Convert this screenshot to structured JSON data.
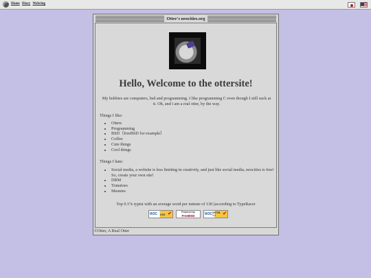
{
  "topbar": {
    "nav": [
      "Home",
      "Diary",
      "Webring"
    ],
    "languages": [
      "jp-flag",
      "us-flag"
    ]
  },
  "window": {
    "title": "Otter's neocities.org"
  },
  "main": {
    "heading": "Hello, Welcome to the ottersite!",
    "intro": "My hobbies are computers, bsd and programming. I like programming C even though I still suck at it. Oh, and i am a real otter, by the way.",
    "likes_label": "Things I like:",
    "likes": [
      "Otters",
      "Programming",
      "BSD（freeBSD for example）",
      "Coffee",
      "Cute things",
      "Cool things"
    ],
    "hates_label": "Things I hate:",
    "hates": [
      "Social media, a website is less limiting in creativity, and just like social media, neocities is free! So, create your own site!",
      "DRM",
      "Tomatoes",
      "Meanies"
    ],
    "typist": "Top 0.1% typist with an average word per minute of 130 (according to TypeRacer",
    "badges": {
      "css": {
        "w3": "W3C",
        "label": "css"
      },
      "bsd": {
        "top": "Powered by",
        "label": "FreeBSD"
      },
      "xhtml": {
        "w3": "W3C",
        "label": "XHTML 1.1"
      }
    }
  },
  "footer": {
    "text": "©Otter, A Real Otter"
  },
  "colors": {
    "background": "#c4bfe4",
    "window": "#d8d8d8"
  }
}
